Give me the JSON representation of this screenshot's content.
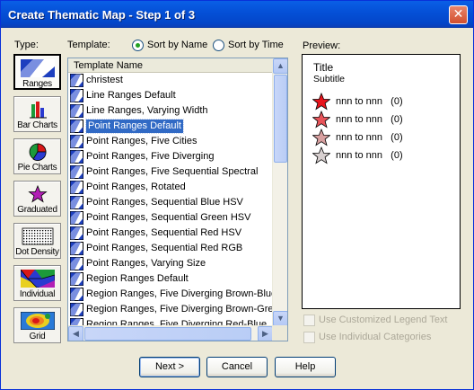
{
  "window": {
    "title": "Create Thematic Map - Step 1 of 3",
    "close_glyph": "✕"
  },
  "type": {
    "label": "Type:",
    "buttons": [
      {
        "label": "Ranges",
        "icon": "ranges-icon",
        "selected": true
      },
      {
        "label": "Bar Charts",
        "icon": "bar-chart-icon"
      },
      {
        "label": "Pie Charts",
        "icon": "pie-chart-icon"
      },
      {
        "label": "Graduated",
        "icon": "graduated-star-icon"
      },
      {
        "label": "Dot Density",
        "icon": "dot-density-icon"
      },
      {
        "label": "Individual",
        "icon": "individual-icon"
      },
      {
        "label": "Grid",
        "icon": "grid-icon"
      }
    ]
  },
  "template": {
    "label": "Template:",
    "sort_by_name": "Sort by Name",
    "sort_by_time": "Sort by Time",
    "sort_selected": "name",
    "column_header": "Template Name",
    "items": [
      "christest",
      "Line Ranges Default",
      "Line Ranges, Varying Width",
      "Point Ranges Default",
      "Point Ranges, Five Cities",
      "Point Ranges, Five Diverging",
      "Point Ranges, Five Sequential Spectral",
      "Point Ranges, Rotated",
      "Point Ranges, Sequential Blue HSV",
      "Point Ranges, Sequential Green HSV",
      "Point Ranges, Sequential Red HSV",
      "Point Ranges, Sequential Red RGB",
      "Point Ranges, Varying Size",
      "Region Ranges Default",
      "Region Ranges, Five Diverging Brown-Blue",
      "Region Ranges, Five Diverging Brown-Gree",
      "Region Ranges, Five Diverging Red-Blue"
    ],
    "selected_index": 3
  },
  "preview": {
    "label": "Preview:",
    "title": "Title",
    "subtitle": "Subtitle",
    "legend": [
      {
        "text": "nnn to nnn",
        "count": "(0)",
        "color": "#e8141c"
      },
      {
        "text": "nnn to nnn",
        "count": "(0)",
        "color": "#e8545a"
      },
      {
        "text": "nnn to nnn",
        "count": "(0)",
        "color": "#d8a0a0"
      },
      {
        "text": "nnn to nnn",
        "count": "(0)",
        "color": "#d8d0d0"
      }
    ]
  },
  "options": {
    "custom_legend": "Use Customized Legend Text",
    "individual_categories": "Use Individual Categories"
  },
  "buttons": {
    "next": "Next >",
    "cancel": "Cancel",
    "help": "Help"
  },
  "colors": {
    "titlebar": "#0551d8",
    "selection": "#316ac5",
    "dialog": "#ece9d8"
  }
}
